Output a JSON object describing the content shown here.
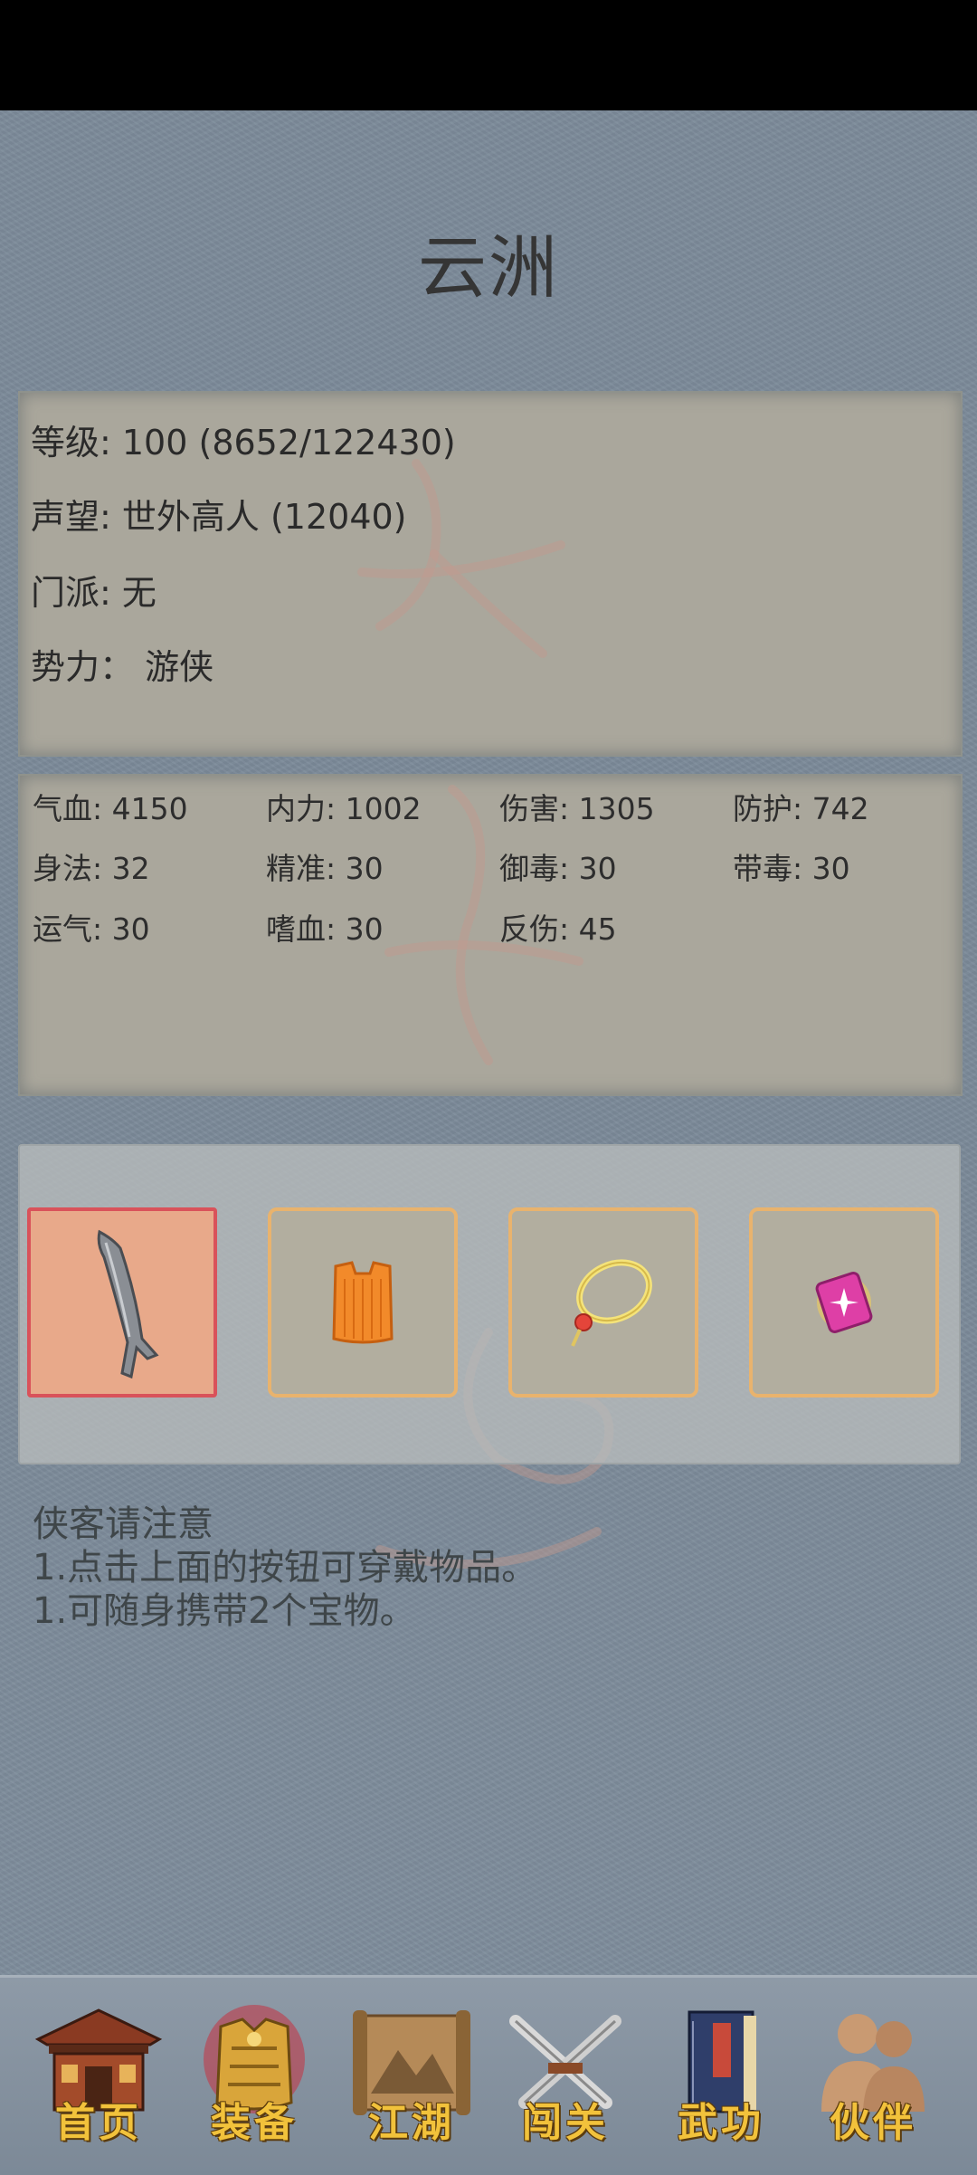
{
  "title": "云洲",
  "info": {
    "level": "等级: 100 (8652/122430)",
    "reputation": "声望: 世外高人 (12040)",
    "sect": "门派: 无",
    "faction": "势力： 游侠"
  },
  "stats": [
    {
      "label": "气血: 4150"
    },
    {
      "label": "内力: 1002"
    },
    {
      "label": "伤害: 1305"
    },
    {
      "label": "防护: 742"
    },
    {
      "label": "身法: 32"
    },
    {
      "label": "精准: 30"
    },
    {
      "label": "御毒: 30"
    },
    {
      "label": "带毒: 30"
    },
    {
      "label": "运气: 30"
    },
    {
      "label": "嗜血: 30"
    },
    {
      "label": "反伤: 45"
    }
  ],
  "equipment": [
    {
      "icon": "broadsword-icon",
      "selected": true
    },
    {
      "icon": "orange-armor-icon",
      "selected": false
    },
    {
      "icon": "necklace-icon",
      "selected": false
    },
    {
      "icon": "pink-gem-icon",
      "selected": false
    }
  ],
  "notice": {
    "line1": "侠客请注意",
    "line2": "1.点击上面的按钮可穿戴物品。",
    "line3": "1.可随身携带2个宝物。"
  },
  "nav": [
    {
      "label": "首页",
      "icon": "house-icon"
    },
    {
      "label": "装备",
      "icon": "armor-icon",
      "active": true
    },
    {
      "label": "江湖",
      "icon": "scroll-map-icon"
    },
    {
      "label": "闯关",
      "icon": "crossed-swords-icon"
    },
    {
      "label": "武功",
      "icon": "book-icon"
    },
    {
      "label": "伙伴",
      "icon": "companions-icon"
    }
  ],
  "colors": {
    "background": "#7b8a99",
    "panel": "#aaa79c",
    "slot_border": "#e9b36d",
    "slot_selected_bg": "#e8a98a",
    "slot_selected_border": "#d9525a",
    "nav_label": "#f2c23b"
  }
}
